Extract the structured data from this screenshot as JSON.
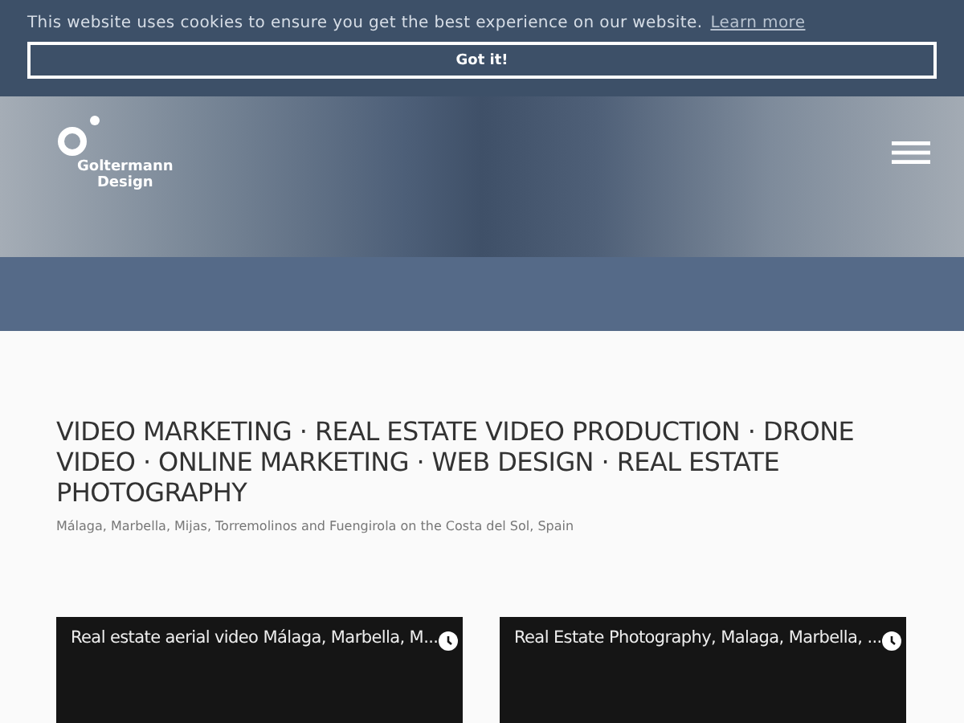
{
  "cookie_bar": {
    "message": "This website uses cookies to ensure you get the best experience on our website.",
    "link": "Learn more",
    "button": "Got it!"
  },
  "header": {
    "logo_text": [
      "Goltermann",
      "Design"
    ]
  },
  "headline": "VIDEO MARKETING · REAL ESTATE VIDEO PRODUCTION · DRONE VIDEO · ONLINE MARKETING · WEB DESIGN · REAL ESTATE PHOTOGRAPHY",
  "subtitle": "Málaga, Marbella, Mijas, Torremolinos and Fuengirola on the Costa del Sol, Spain",
  "videos": [
    {
      "title": "Real estate aerial video Málaga, Marbella, M..."
    },
    {
      "title": "Real Estate Photography, Malaga, Marbella, ..."
    }
  ]
}
